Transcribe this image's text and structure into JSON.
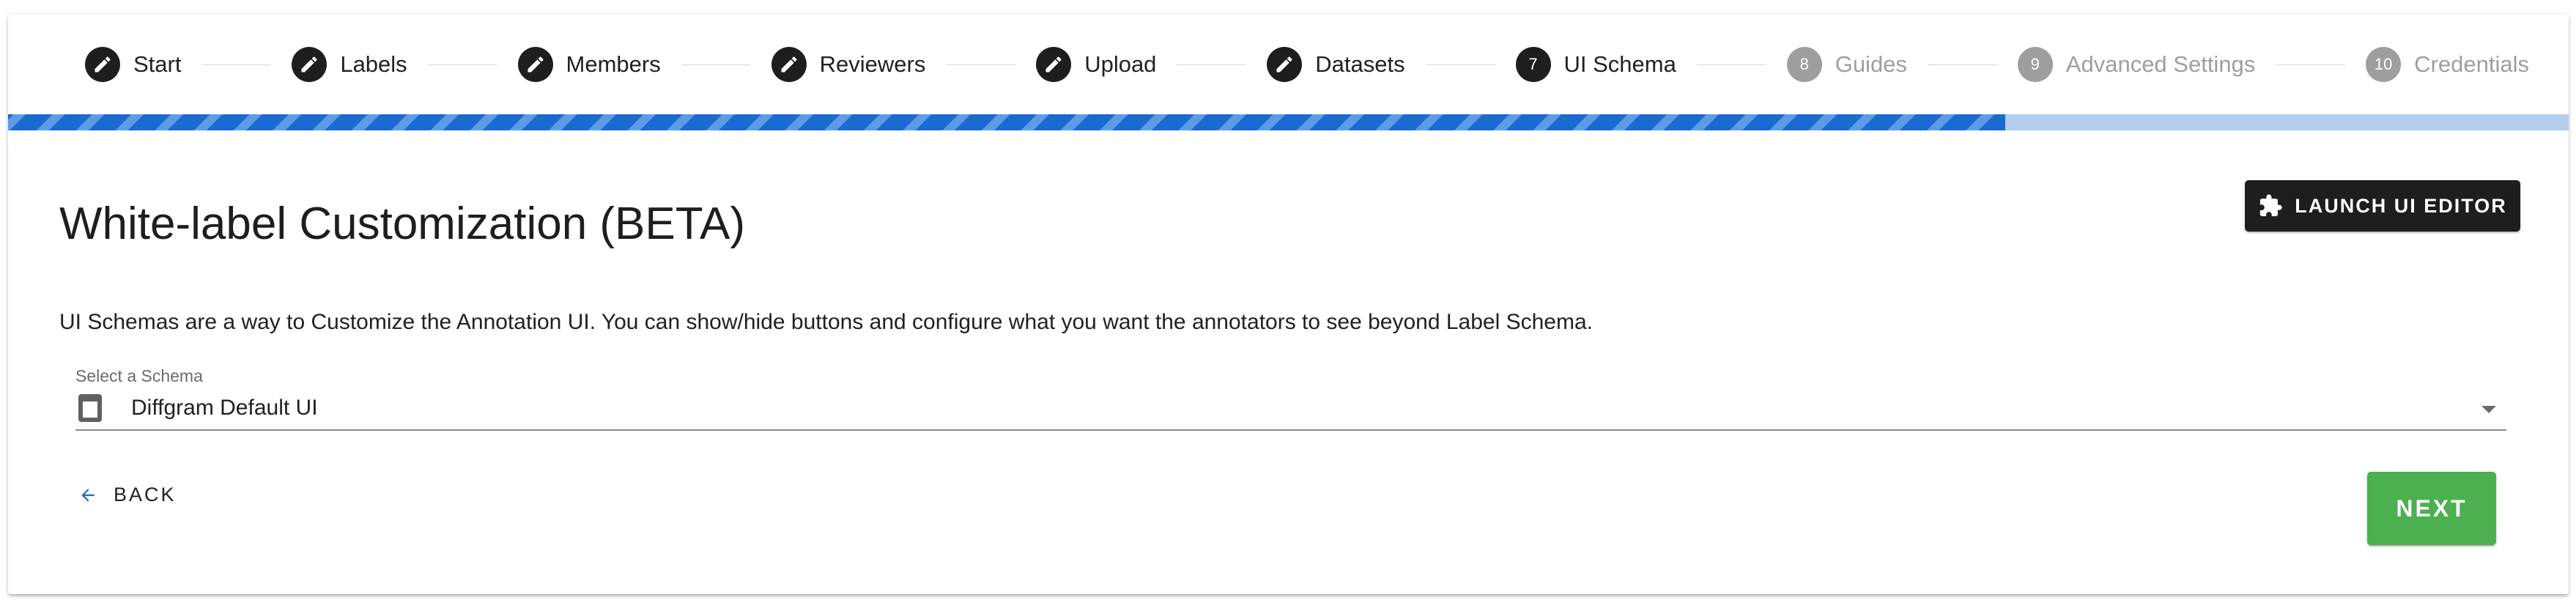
{
  "stepper": {
    "steps": [
      {
        "label": "Start",
        "state": "complete",
        "icon": "pencil-icon"
      },
      {
        "label": "Labels",
        "state": "complete",
        "icon": "pencil-icon"
      },
      {
        "label": "Members",
        "state": "complete",
        "icon": "pencil-icon"
      },
      {
        "label": "Reviewers",
        "state": "complete",
        "icon": "pencil-icon"
      },
      {
        "label": "Upload",
        "state": "complete",
        "icon": "pencil-icon"
      },
      {
        "label": "Datasets",
        "state": "complete",
        "icon": "pencil-icon"
      },
      {
        "label": "UI Schema",
        "state": "active",
        "number": "7"
      },
      {
        "label": "Guides",
        "state": "inactive",
        "number": "8"
      },
      {
        "label": "Advanced Settings",
        "state": "inactive",
        "number": "9"
      },
      {
        "label": "Credentials",
        "state": "inactive",
        "number": "10"
      }
    ]
  },
  "progress": {
    "fraction": 0.78,
    "fill_color": "#1a6ad2",
    "track_color": "#b3cdee"
  },
  "page": {
    "title": "White-label Customization (BETA)",
    "description": "UI Schemas are a way to Customize the Annotation UI. You can show/hide buttons and configure what you want the annotators to see beyond Label Schema."
  },
  "launch_button": {
    "label": "LAUNCH UI EDITOR",
    "icon": "puzzle-icon"
  },
  "schema_select": {
    "label": "Select a Schema",
    "value": "Diffgram Default UI",
    "icon": "window-icon"
  },
  "actions": {
    "back_label": "BACK",
    "next_label": "NEXT",
    "next_color": "#4caf50"
  }
}
